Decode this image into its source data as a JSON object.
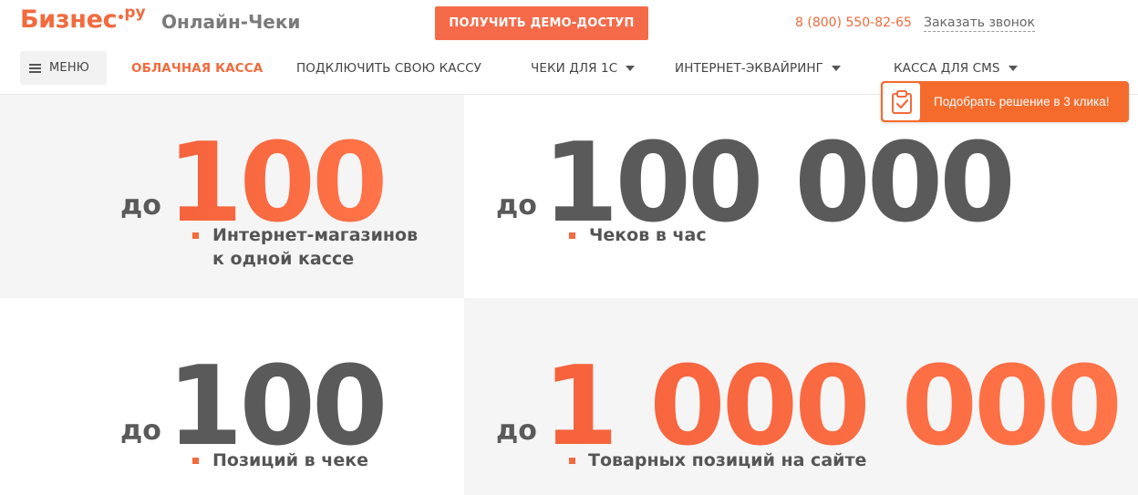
{
  "header": {
    "logo_text": "Бизнес",
    "logo_suffix": "ру",
    "product_name": "Онлайн-Чеки",
    "demo_button": "ПОЛУЧИТЬ ДЕМО-ДОСТУП",
    "phone": "8 (800) 550-82-65",
    "callback_link": "Заказать звонок"
  },
  "nav": {
    "menu_label": "МЕНЮ",
    "items": [
      {
        "label": "ОБЛАЧНАЯ КАССА",
        "active": true,
        "dropdown": false
      },
      {
        "label": "ПОДКЛЮЧИТЬ СВОЮ КАССУ",
        "active": false,
        "dropdown": false
      },
      {
        "label": "ЧЕКИ ДЛЯ 1С",
        "active": false,
        "dropdown": true
      },
      {
        "label": "ИНТЕРНЕТ-ЭКВАЙРИНГ",
        "active": false,
        "dropdown": true
      },
      {
        "label": "КАССА ДЛЯ CMS",
        "active": false,
        "dropdown": true
      }
    ]
  },
  "picker": {
    "label": "Подобрать решение в 3 клика!",
    "icon": "clipboard-check-icon"
  },
  "stats": [
    {
      "prefix": "до",
      "value": "100",
      "description_line1": "Интернет-магазинов",
      "description_line2": "к одной кассе",
      "highlight": true
    },
    {
      "prefix": "до",
      "value": "100 000",
      "description_line1": "Чеков в час",
      "highlight": false
    },
    {
      "prefix": "до",
      "value": "100",
      "description_line1": "Позиций в чеке",
      "highlight": false
    },
    {
      "prefix": "до",
      "value": "1 000 000",
      "description_line1": "Товарных позиций на сайте",
      "highlight": true
    }
  ],
  "colors": {
    "accent": "#f26a3d",
    "button": "#f56b4a",
    "dark_text": "#5a5a5a",
    "panel_gray": "#f5f5f5"
  }
}
